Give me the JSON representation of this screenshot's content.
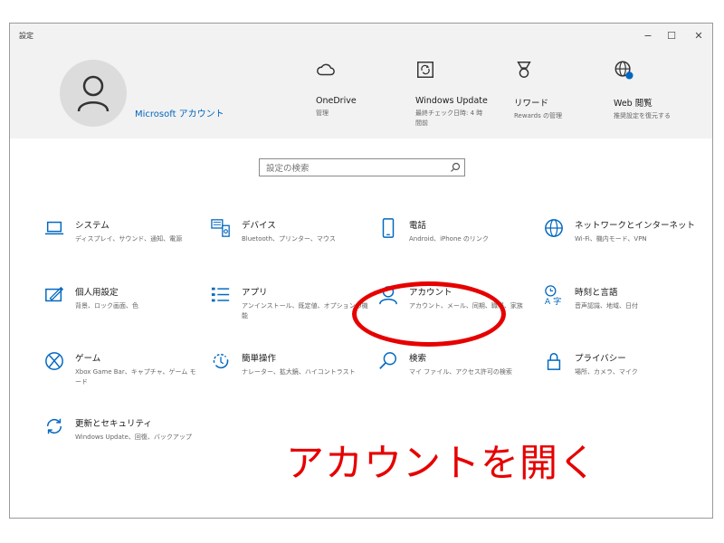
{
  "window": {
    "title": "設定",
    "minimize_glyph": "−",
    "maximize_glyph": "☐",
    "close_glyph": "✕"
  },
  "account": {
    "name": "Microsoft アカウント"
  },
  "quick_links": [
    {
      "label": "OneDrive",
      "sub": "管理",
      "icon": "cloud-icon"
    },
    {
      "label": "Windows Update",
      "sub": "最終チェック日時: 4 時間前",
      "icon": "update-icon"
    },
    {
      "label": "リワード",
      "sub": "Rewards の管理",
      "icon": "rewards-medal-icon"
    },
    {
      "label": "Web 閲覧",
      "sub": "推奨設定を復元する",
      "icon": "globe-icon"
    }
  ],
  "search": {
    "placeholder": "設定の検索"
  },
  "tiles": [
    {
      "label": "システム",
      "sub": "ディスプレイ、サウンド、通知、電源",
      "icon": "laptop-icon"
    },
    {
      "label": "デバイス",
      "sub": "Bluetooth、プリンター、マウス",
      "icon": "devices-icon"
    },
    {
      "label": "電話",
      "sub": "Android、iPhone のリンク",
      "icon": "phone-icon"
    },
    {
      "label": "ネットワークとインターネット",
      "sub": "Wi-Fi、機内モード、VPN",
      "icon": "globe-icon"
    },
    {
      "label": "個人用設定",
      "sub": "背景、ロック画面、色",
      "icon": "personalization-icon"
    },
    {
      "label": "アプリ",
      "sub": "アンインストール、既定値、オプションの機能",
      "icon": "apps-list-icon"
    },
    {
      "label": "アカウント",
      "sub": "アカウント、メール、同期、職場、家族",
      "icon": "person-icon"
    },
    {
      "label": "時刻と言語",
      "sub": "音声認識、地域、日付",
      "icon": "time-language-icon"
    },
    {
      "label": "ゲーム",
      "sub": "Xbox Game Bar、キャプチャ、ゲーム モード",
      "icon": "xbox-icon"
    },
    {
      "label": "簡単操作",
      "sub": "ナレーター、拡大鏡、ハイコントラスト",
      "icon": "ease-of-access-icon"
    },
    {
      "label": "検索",
      "sub": "マイ ファイル、アクセス許可の検索",
      "icon": "search-icon"
    },
    {
      "label": "プライバシー",
      "sub": "場所、カメラ、マイク",
      "icon": "lock-icon"
    },
    {
      "label": "更新とセキュリティ",
      "sub": "Windows Update、回復、バックアップ",
      "icon": "sync-icon"
    }
  ],
  "annotation": {
    "text": "アカウントを開く",
    "color": "#e60000"
  },
  "colors": {
    "accent": "#0067c0",
    "header_bg": "#f2f2f2"
  }
}
